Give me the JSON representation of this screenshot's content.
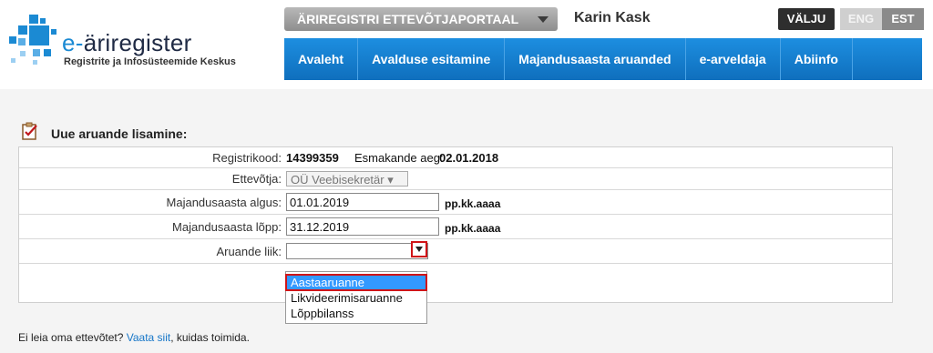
{
  "header": {
    "logo_prefix": "e-",
    "logo_name": "äriregister",
    "logo_subtitle": "Registrite ja Infosüsteemide Keskus",
    "portal_label": "ÄRIREGISTRI ETTEVÕTJAPORTAAL",
    "user_name": "Karin Kask",
    "logout_label": "VÄLJU",
    "lang_eng": "ENG",
    "lang_est": "EST"
  },
  "nav": [
    "Avaleht",
    "Avalduse esitamine",
    "Majandusaasta aruanded",
    "e-arveldaja",
    "Abiinfo"
  ],
  "form": {
    "title": "Uue aruande lisamine:",
    "reg_label": "Registrikood:",
    "reg_value": "14399359",
    "first_entry_label": "Esmakande aeg:",
    "first_entry_value": "02.01.2018",
    "company_label": "Ettevõtja:",
    "company_value": "OÜ Veebisekretär",
    "start_label": "Majandusaasta algus:",
    "start_value": "01.01.2019",
    "end_label": "Majandusaasta lõpp:",
    "end_value": "31.12.2019",
    "date_hint": "pp.kk.aaaa",
    "type_label": "Aruande liik:",
    "type_value": "",
    "type_options": [
      "Aastaaruanne",
      "Likvideerimisaruanne",
      "Lõppbilanss"
    ]
  },
  "footer": {
    "text_before": "Ei leia oma ettevõtet?",
    "link": "Vaata siit",
    "text_after": ", kuidas toimida."
  },
  "colors": {
    "nav_blue": "#1580d4",
    "highlight_red": "#d01418",
    "select_blue": "#3399ff"
  }
}
